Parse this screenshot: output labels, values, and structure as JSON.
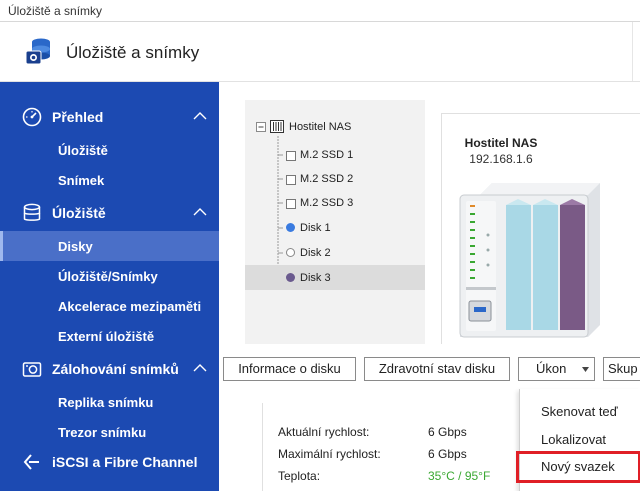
{
  "window": {
    "title": "Úložiště a snímky"
  },
  "header": {
    "title": "Úložiště a snímky"
  },
  "sidebar": {
    "sections": [
      {
        "label": "Přehled",
        "items": [
          "Úložiště",
          "Snímek"
        ]
      },
      {
        "label": "Úložiště",
        "items": [
          "Disky",
          "Úložiště/Snímky",
          "Akcelerace mezipaměti",
          "Externí úložiště"
        ]
      },
      {
        "label": "Zálohování snímků",
        "items": [
          "Replika snímku",
          "Trezor snímku"
        ]
      },
      {
        "label": "iSCSI a Fibre Channel",
        "items": []
      }
    ],
    "active_item": "Disky"
  },
  "tree": {
    "root": "Hostitel NAS",
    "nodes": [
      {
        "label": "M.2 SSD 1",
        "marker": "checkbox"
      },
      {
        "label": "M.2 SSD 2",
        "marker": "checkbox"
      },
      {
        "label": "M.2 SSD 3",
        "marker": "checkbox"
      },
      {
        "label": "Disk 1",
        "marker": "blue-dot"
      },
      {
        "label": "Disk 2",
        "marker": "empty-dot"
      },
      {
        "label": "Disk 3",
        "marker": "purple-dot",
        "selected": true
      }
    ]
  },
  "device": {
    "name": "Hostitel NAS",
    "ip": "192.168.1.6"
  },
  "tabs": {
    "info": "Informace o disku",
    "health": "Zdravotní stav disku",
    "action": "Úkon",
    "group": "Skup"
  },
  "info": {
    "rows": [
      {
        "label": "Aktuální rychlost:",
        "value": "6 Gbps"
      },
      {
        "label": "Maximální rychlost:",
        "value": "6 Gbps"
      },
      {
        "label": "Teplota:",
        "value": "35°C / 95°F",
        "value_color": "#3aa832"
      }
    ]
  },
  "action_menu": {
    "items": [
      "Skenovat teď",
      "Lokalizovat",
      "Nový svazek"
    ],
    "highlighted": "Nový svazek",
    "highlight_color": "#e01f26"
  },
  "colors": {
    "sidebar_bg": "#1c4ab2",
    "sidebar_active": "#4a6fc8",
    "disk1": "#3a7be0",
    "disk3": "#6a5a8e",
    "bay_light": "#a9d8e6",
    "bay_purple": "#7a5a86"
  }
}
